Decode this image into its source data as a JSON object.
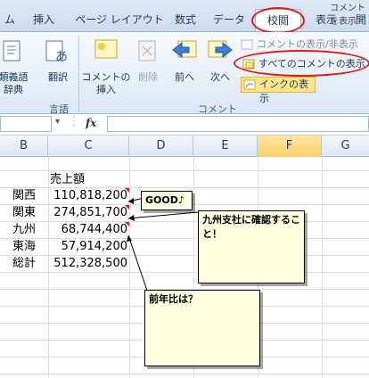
{
  "tabs": [
    {
      "label": "ム"
    },
    {
      "label": "挿入"
    },
    {
      "label": "ページ レイアウト"
    },
    {
      "label": "数式"
    },
    {
      "label": "データ"
    },
    {
      "label": "校閲"
    },
    {
      "label": "表示"
    },
    {
      "label": "開"
    }
  ],
  "title_fragment": "コメントを表示",
  "ribbon": {
    "thesaurus_label": "類義語\n辞典",
    "translate_label": "翻訳",
    "language_group": "言語",
    "new_comment_label": "コメントの\n挿入",
    "delete_label": "削除",
    "prev_label": "前へ",
    "next_label": "次へ",
    "show_hide_label": "コメントの表示/非表示",
    "show_all_label": "すべてのコメントの表示",
    "show_ink_label": "インクの表示",
    "comment_group": "コメント"
  },
  "formula_bar": {
    "fx": "fx",
    "name_box": "",
    "formula": ""
  },
  "columns": [
    "B",
    "C",
    "D",
    "E",
    "F",
    "G"
  ],
  "sheet": {
    "header": "売上額",
    "rows": [
      {
        "label": "関西",
        "value": "110,818,200"
      },
      {
        "label": "関東",
        "value": "274,851,700"
      },
      {
        "label": "九州",
        "value": "68,744,400"
      },
      {
        "label": "東海",
        "value": "57,914,200"
      },
      {
        "label": "総計",
        "value": "512,328,500"
      }
    ]
  },
  "comments": {
    "c1": "GOOD♪",
    "c2": "九州支社に確認すること！",
    "c3": "前年比は？"
  },
  "colors": {
    "highlight_ring": "#e0191e",
    "comment_fill": "#ffffe1",
    "active_column": "#f9cf6b"
  }
}
